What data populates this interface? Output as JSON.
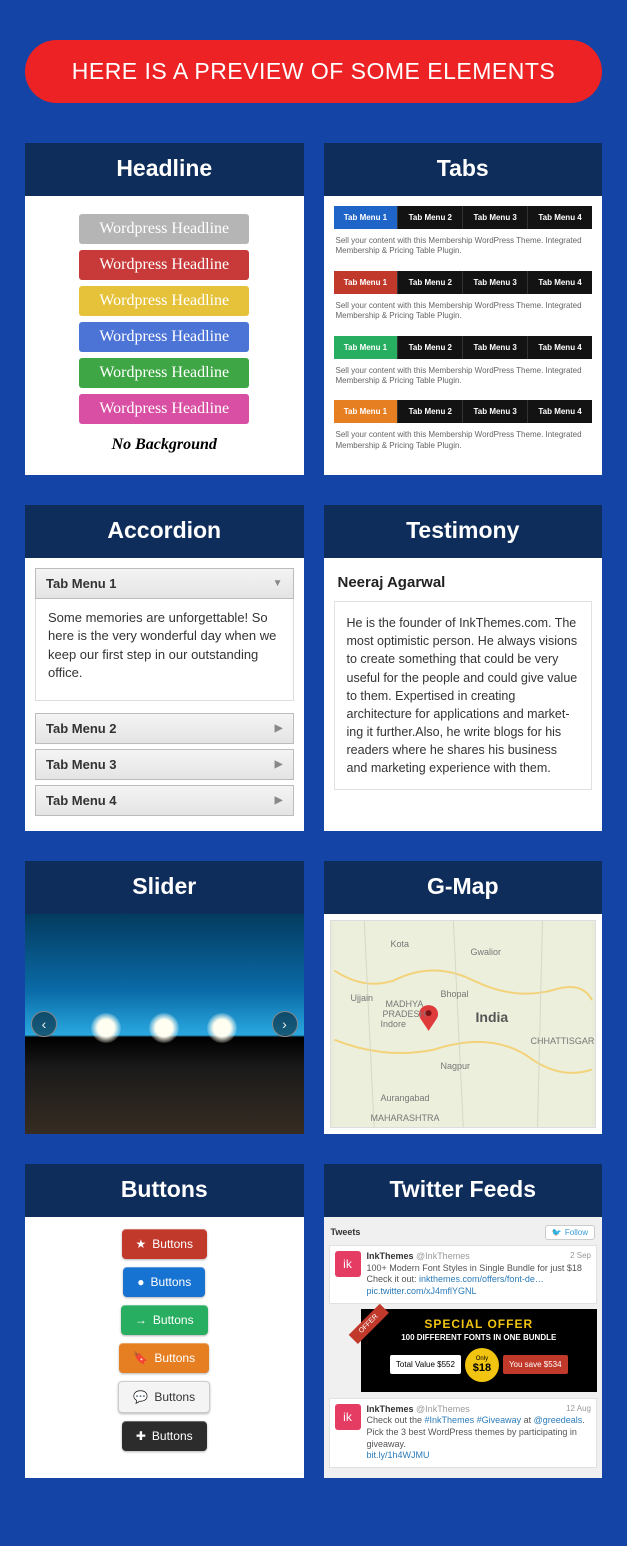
{
  "banner": "HERE IS A PREVIEW OF SOME ELEMENTS",
  "cards": {
    "headline": {
      "title": "Headline",
      "items": [
        "Wordpress Headline",
        "Wordpress Headline",
        "Wordpress Headline",
        "Wordpress Headline",
        "Wordpress Headline",
        "Wordpress Headline",
        "No Background"
      ]
    },
    "tabs": {
      "title": "Tabs",
      "menus": [
        "Tab Menu 1",
        "Tab Menu 2",
        "Tab Menu 3",
        "Tab Menu 4"
      ],
      "desc": "Sell your content with this Membership WordPress Theme. Integrated Membership & Pricing Table Plugin."
    },
    "accordion": {
      "title": "Accordion",
      "items": [
        "Tab Menu 1",
        "Tab Menu 2",
        "Tab Menu 3",
        "Tab Menu 4"
      ],
      "content": "Some memories are unforgettable! So here is the very wonderful day when we keep our first step in our outstanding office."
    },
    "testimony": {
      "title": "Testimony",
      "name": "Neeraj Agarwal",
      "text": "He is the founder of InkThemes.com. The most optimistic person. He always visions to create something that could be very useful for the people and could give value to them. Expertised in creating architecture for applications and market­ing it further.Also, he write blogs for his readers where he shares his business and marketing experience with them."
    },
    "slider": {
      "title": "Slider"
    },
    "gmap": {
      "title": "G-Map",
      "labels": {
        "india": "India",
        "madhya": "MADHYA",
        "pradesh": "PRADESH",
        "bhopal": "Bhopal",
        "indore": "Indore",
        "nagpur": "Nagpur",
        "aurangabad": "Aurangabad",
        "kota": "Kota",
        "gwalior": "Gwalior",
        "ujjain": "Ujjain",
        "maharashtra": "MAHARASHTRA",
        "chhattisgarh": "CHHATTISGARI"
      }
    },
    "buttons": {
      "title": "Buttons",
      "label": "Buttons"
    },
    "twitter": {
      "title": "Twitter Feeds",
      "tweets_label": "Tweets",
      "follow": "Follow",
      "user": "InkThemes",
      "handle": "@InkThemes",
      "t1_date": "2 Sep",
      "t1_line": "100+ Modern Font Styles in Single Bundle for just $18",
      "t1_prefix": "Check it out: ",
      "t1_link1": "inkthemes.com/offers/font-de…",
      "t1_link2": "pic.twitter.com/xJ4mflYGNL",
      "offer_tag": "OFFER",
      "offer_title": "SPECIAL OFFER",
      "offer_sub": "100 DIFFERENT FONTS IN ONE BUNDLE",
      "offer_total": "Total Value $552",
      "offer_only": "Only",
      "offer_price": "$18",
      "offer_save": "You save $534",
      "t2_date": "12 Aug",
      "t2_a": "Check out the ",
      "t2_b": "#InkThemes",
      "t2_c": " #Giveaway",
      "t2_d": " at ",
      "t2_e": "@greedeals",
      "t2_f": ". Pick the 3 best WordPress themes by participating in giveaway.",
      "t2_link": "bit.ly/1h4WJMU"
    }
  }
}
